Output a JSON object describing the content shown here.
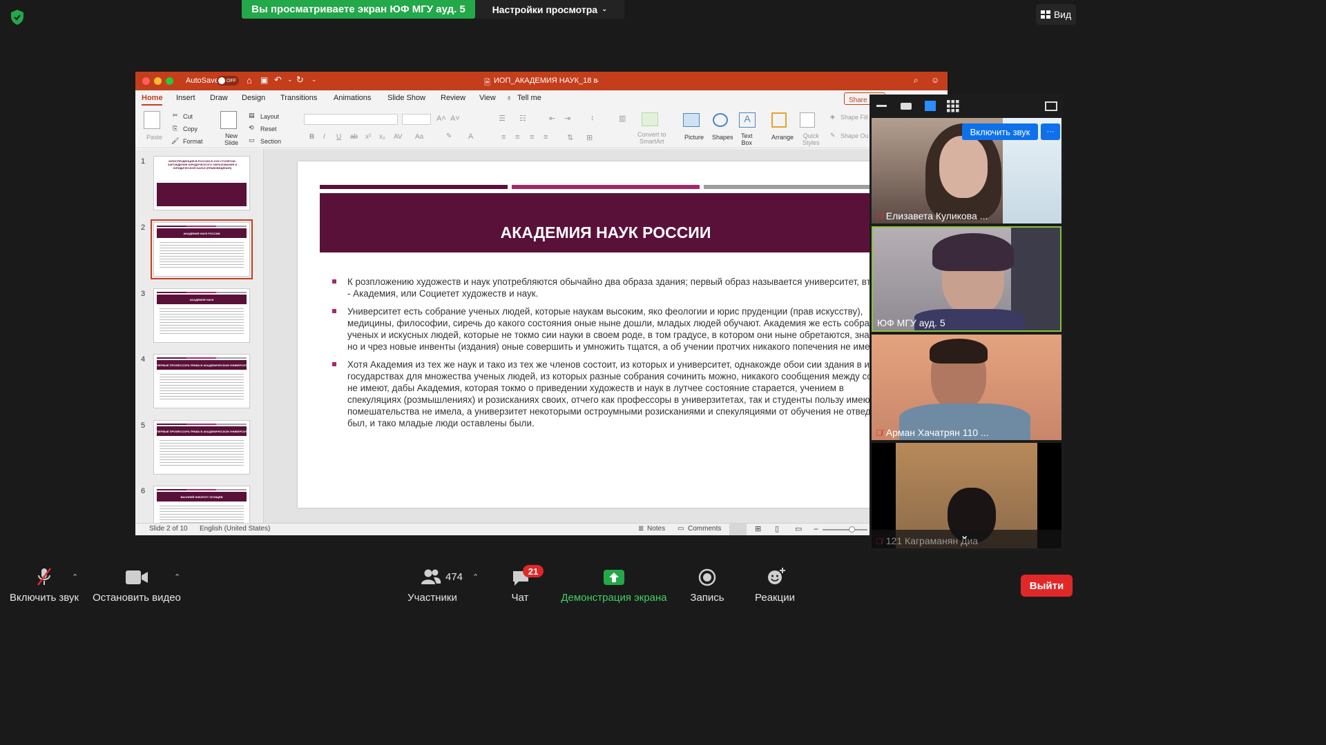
{
  "zoom": {
    "banner_text": "Вы просматриваете экран ЮФ МГУ ауд. 5",
    "view_options_label": "Настройки просмотра",
    "view_button_label": "Вид",
    "colors": {
      "green": "#23a84a",
      "accent_blue": "#0e71eb",
      "leave_red": "#e02828"
    }
  },
  "ppt": {
    "autosave_label": "AutoSave",
    "autosave_state": "OFF",
    "doc_title": "ИОП_АКАДЕМИЯ НАУК_18 в",
    "share_label": "Share",
    "tabs": [
      "Home",
      "Insert",
      "Draw",
      "Design",
      "Transitions",
      "Animations",
      "Slide Show",
      "Review",
      "View"
    ],
    "tell_me": "Tell me",
    "ribbon": {
      "paste": "Paste",
      "cut": "Cut",
      "copy": "Copy",
      "format": "Format",
      "new_slide": "New\nSlide",
      "layout": "Layout",
      "reset": "Reset",
      "section": "Section",
      "convert": "Convert to\nSmartArt",
      "picture": "Picture",
      "shapes": "Shapes",
      "text_box": "Text\nBox",
      "arrange": "Arrange",
      "quick_styles": "Quick\nStyles",
      "shape_fill": "Shape Fill",
      "shape_outline": "Shape Ou"
    },
    "thumbnails": [
      {
        "num": "1",
        "title": "ЮРИСПРУДЕНЦИЯ В РОССИИ В XVIII СТОЛЕТИИ. ЗАРОЖДЕНИЕ ЮРИДИЧЕСКОГО ОБРАЗОВАНИЯ И ЮРИДИЧЕСКОЙ НАУКИ (ПРАВОВЕДЕНИЯ)"
      },
      {
        "num": "2",
        "title": "АКАДЕМИЯ НАУК РОССИИ"
      },
      {
        "num": "3",
        "title": "АКАДЕМИЯ НАУК"
      },
      {
        "num": "4",
        "title": "ПЕРВЫЕ ПРОФЕССОРА ПРАВА В АКАДЕМИЧЕСКОМ УНИВЕРСИТЕТЕ"
      },
      {
        "num": "5",
        "title": "ПЕРВЫЕ ПРОФЕССОРА ПРАВА В АКАДЕМИЧЕСКОМ УНИВЕРСИТЕТЕ"
      },
      {
        "num": "6",
        "title": "ВАСИЛИЙ НИКИТИЧ ТАТИЩЕВ"
      }
    ],
    "slide": {
      "title": "АКАДЕМИЯ НАУК РОССИИ",
      "bullets": [
        "К розпложению художеств и наук употребляются обычайно два образа здания; первый образ называется университет, второй - Академия, или Социетет художеств и наук.",
        "Университет есть собрание ученых людей, которые наукам высоким, яко феологии и юрис пруденции (прав искусству), медицины, философии, сиречь до какого состояния оные ныне дошли, младых людей обучают. Академия же есть собрание ученых и искусных людей, которые не токмо сии науки в своем роде, в том градусе, в котором они ныне обретаются, знают, но и чрез новые инвенты (издания) оные совершить и умножить тщатся, а об учении протчих никакого попечения не имеют.",
        "Хотя Академия из тех же наук и тако из тех же членов состоит, из которых и университет, однакожде обои сии здания в иных государствах для множества ученых людей, из которых разные собрания сочинить можно, никакого сообщения между собою не имеют, дабы Академия, которая токмо о приведении художеств и наук в лутчее состояние старается, учением в спекуляциях (розмышлениях) и розисканиях своих, отчего как профессоры в универзитетах, так и студенты пользу имеют, помешательства не имела, а универзитет некоторыми остроумными розисканиями и спекуляциями от обучения не отведен был, и тако младые люди оставлены были."
      ]
    },
    "status": {
      "slide_of": "Slide 2 of 10",
      "language": "English (United States)",
      "notes": "Notes",
      "comments": "Comments"
    }
  },
  "participants": {
    "unmute_button": "Включить звук",
    "more_button": "···",
    "tiles": [
      {
        "name": "Елизавета Куликова ...",
        "muted": true
      },
      {
        "name": "ЮФ МГУ ауд. 5",
        "muted": false,
        "active": true
      },
      {
        "name": "Арман Хачатрян 110 ...",
        "muted": true
      },
      {
        "name": "121 Каграманян Диа",
        "muted": true
      }
    ]
  },
  "toolbar": {
    "unmute": "Включить звук",
    "stop_video": "Остановить видео",
    "participants": "Участники",
    "participants_count": "474",
    "chat": "Чат",
    "chat_badge": "21",
    "share_screen": "Демонстрация экрана",
    "record": "Запись",
    "reactions": "Реакции",
    "leave": "Выйти"
  }
}
